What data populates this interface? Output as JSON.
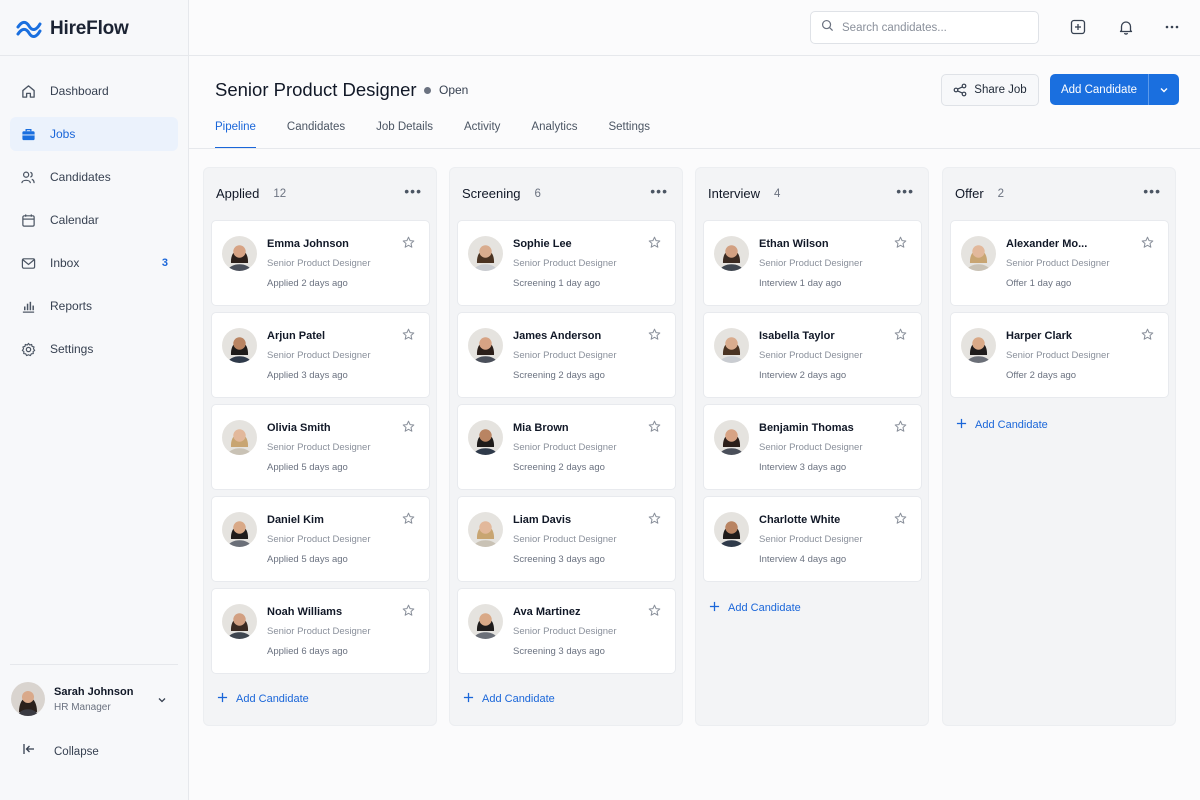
{
  "brand": {
    "name": "HireFlow",
    "accent": "#1a6fdf"
  },
  "sidebar": {
    "items": [
      {
        "label": "Dashboard",
        "icon": "home-icon"
      },
      {
        "label": "Jobs",
        "icon": "briefcase-icon",
        "active": true
      },
      {
        "label": "Candidates",
        "icon": "users-icon"
      },
      {
        "label": "Calendar",
        "icon": "calendar-icon"
      },
      {
        "label": "Inbox",
        "icon": "mail-icon",
        "badge": "3"
      },
      {
        "label": "Reports",
        "icon": "bar-chart-icon"
      },
      {
        "label": "Settings",
        "icon": "gear-icon"
      }
    ],
    "user": {
      "name": "Sarah Johnson",
      "role": "HR Manager"
    },
    "collapse_label": "Collapse"
  },
  "topbar": {
    "search_placeholder": "Search candidates..."
  },
  "header": {
    "title": "Senior Product Designer",
    "status": "Open",
    "share_label": "Share Job",
    "add_label": "Add Candidate"
  },
  "tabs": [
    {
      "label": "Pipeline",
      "active": true
    },
    {
      "label": "Candidates"
    },
    {
      "label": "Job Details"
    },
    {
      "label": "Activity"
    },
    {
      "label": "Analytics"
    },
    {
      "label": "Settings"
    }
  ],
  "columns": [
    {
      "title": "Applied",
      "count": "12",
      "add_label": "Add Candidate",
      "cards": [
        {
          "name": "Emma Johnson",
          "role": "Senior Product Designer",
          "status": "Applied 2 days ago"
        },
        {
          "name": "Arjun Patel",
          "role": "Senior Product Designer",
          "status": "Applied 3 days ago"
        },
        {
          "name": "Olivia Smith",
          "role": "Senior Product Designer",
          "status": "Applied 5 days ago"
        },
        {
          "name": "Daniel Kim",
          "role": "Senior Product Designer",
          "status": "Applied 5 days ago"
        },
        {
          "name": "Noah Williams",
          "role": "Senior Product Designer",
          "status": "Applied 6 days ago"
        }
      ]
    },
    {
      "title": "Screening",
      "count": "6",
      "add_label": "Add Candidate",
      "cards": [
        {
          "name": "Sophie Lee",
          "role": "Senior Product Designer",
          "status": "Screening 1 day ago"
        },
        {
          "name": "James Anderson",
          "role": "Senior Product Designer",
          "status": "Screening 2 days ago"
        },
        {
          "name": "Mia Brown",
          "role": "Senior Product Designer",
          "status": "Screening 2 days ago"
        },
        {
          "name": "Liam Davis",
          "role": "Senior Product Designer",
          "status": "Screening 3 days ago"
        },
        {
          "name": "Ava Martinez",
          "role": "Senior Product Designer",
          "status": "Screening 3 days ago"
        }
      ]
    },
    {
      "title": "Interview",
      "count": "4",
      "add_label": "Add Candidate",
      "cards": [
        {
          "name": "Ethan Wilson",
          "role": "Senior Product Designer",
          "status": "Interview 1 day ago"
        },
        {
          "name": "Isabella Taylor",
          "role": "Senior Product Designer",
          "status": "Interview 2 days ago"
        },
        {
          "name": "Benjamin Thomas",
          "role": "Senior Product Designer",
          "status": "Interview 3 days ago"
        },
        {
          "name": "Charlotte White",
          "role": "Senior Product Designer",
          "status": "Interview 4 days ago"
        }
      ]
    },
    {
      "title": "Offer",
      "count": "2",
      "add_label": "Add Candidate",
      "cards": [
        {
          "name": "Alexander Mo...",
          "role": "Senior Product Designer",
          "status": "Offer 1 day ago"
        },
        {
          "name": "Harper Clark",
          "role": "Senior Product Designer",
          "status": "Offer 2 days ago"
        }
      ]
    }
  ]
}
